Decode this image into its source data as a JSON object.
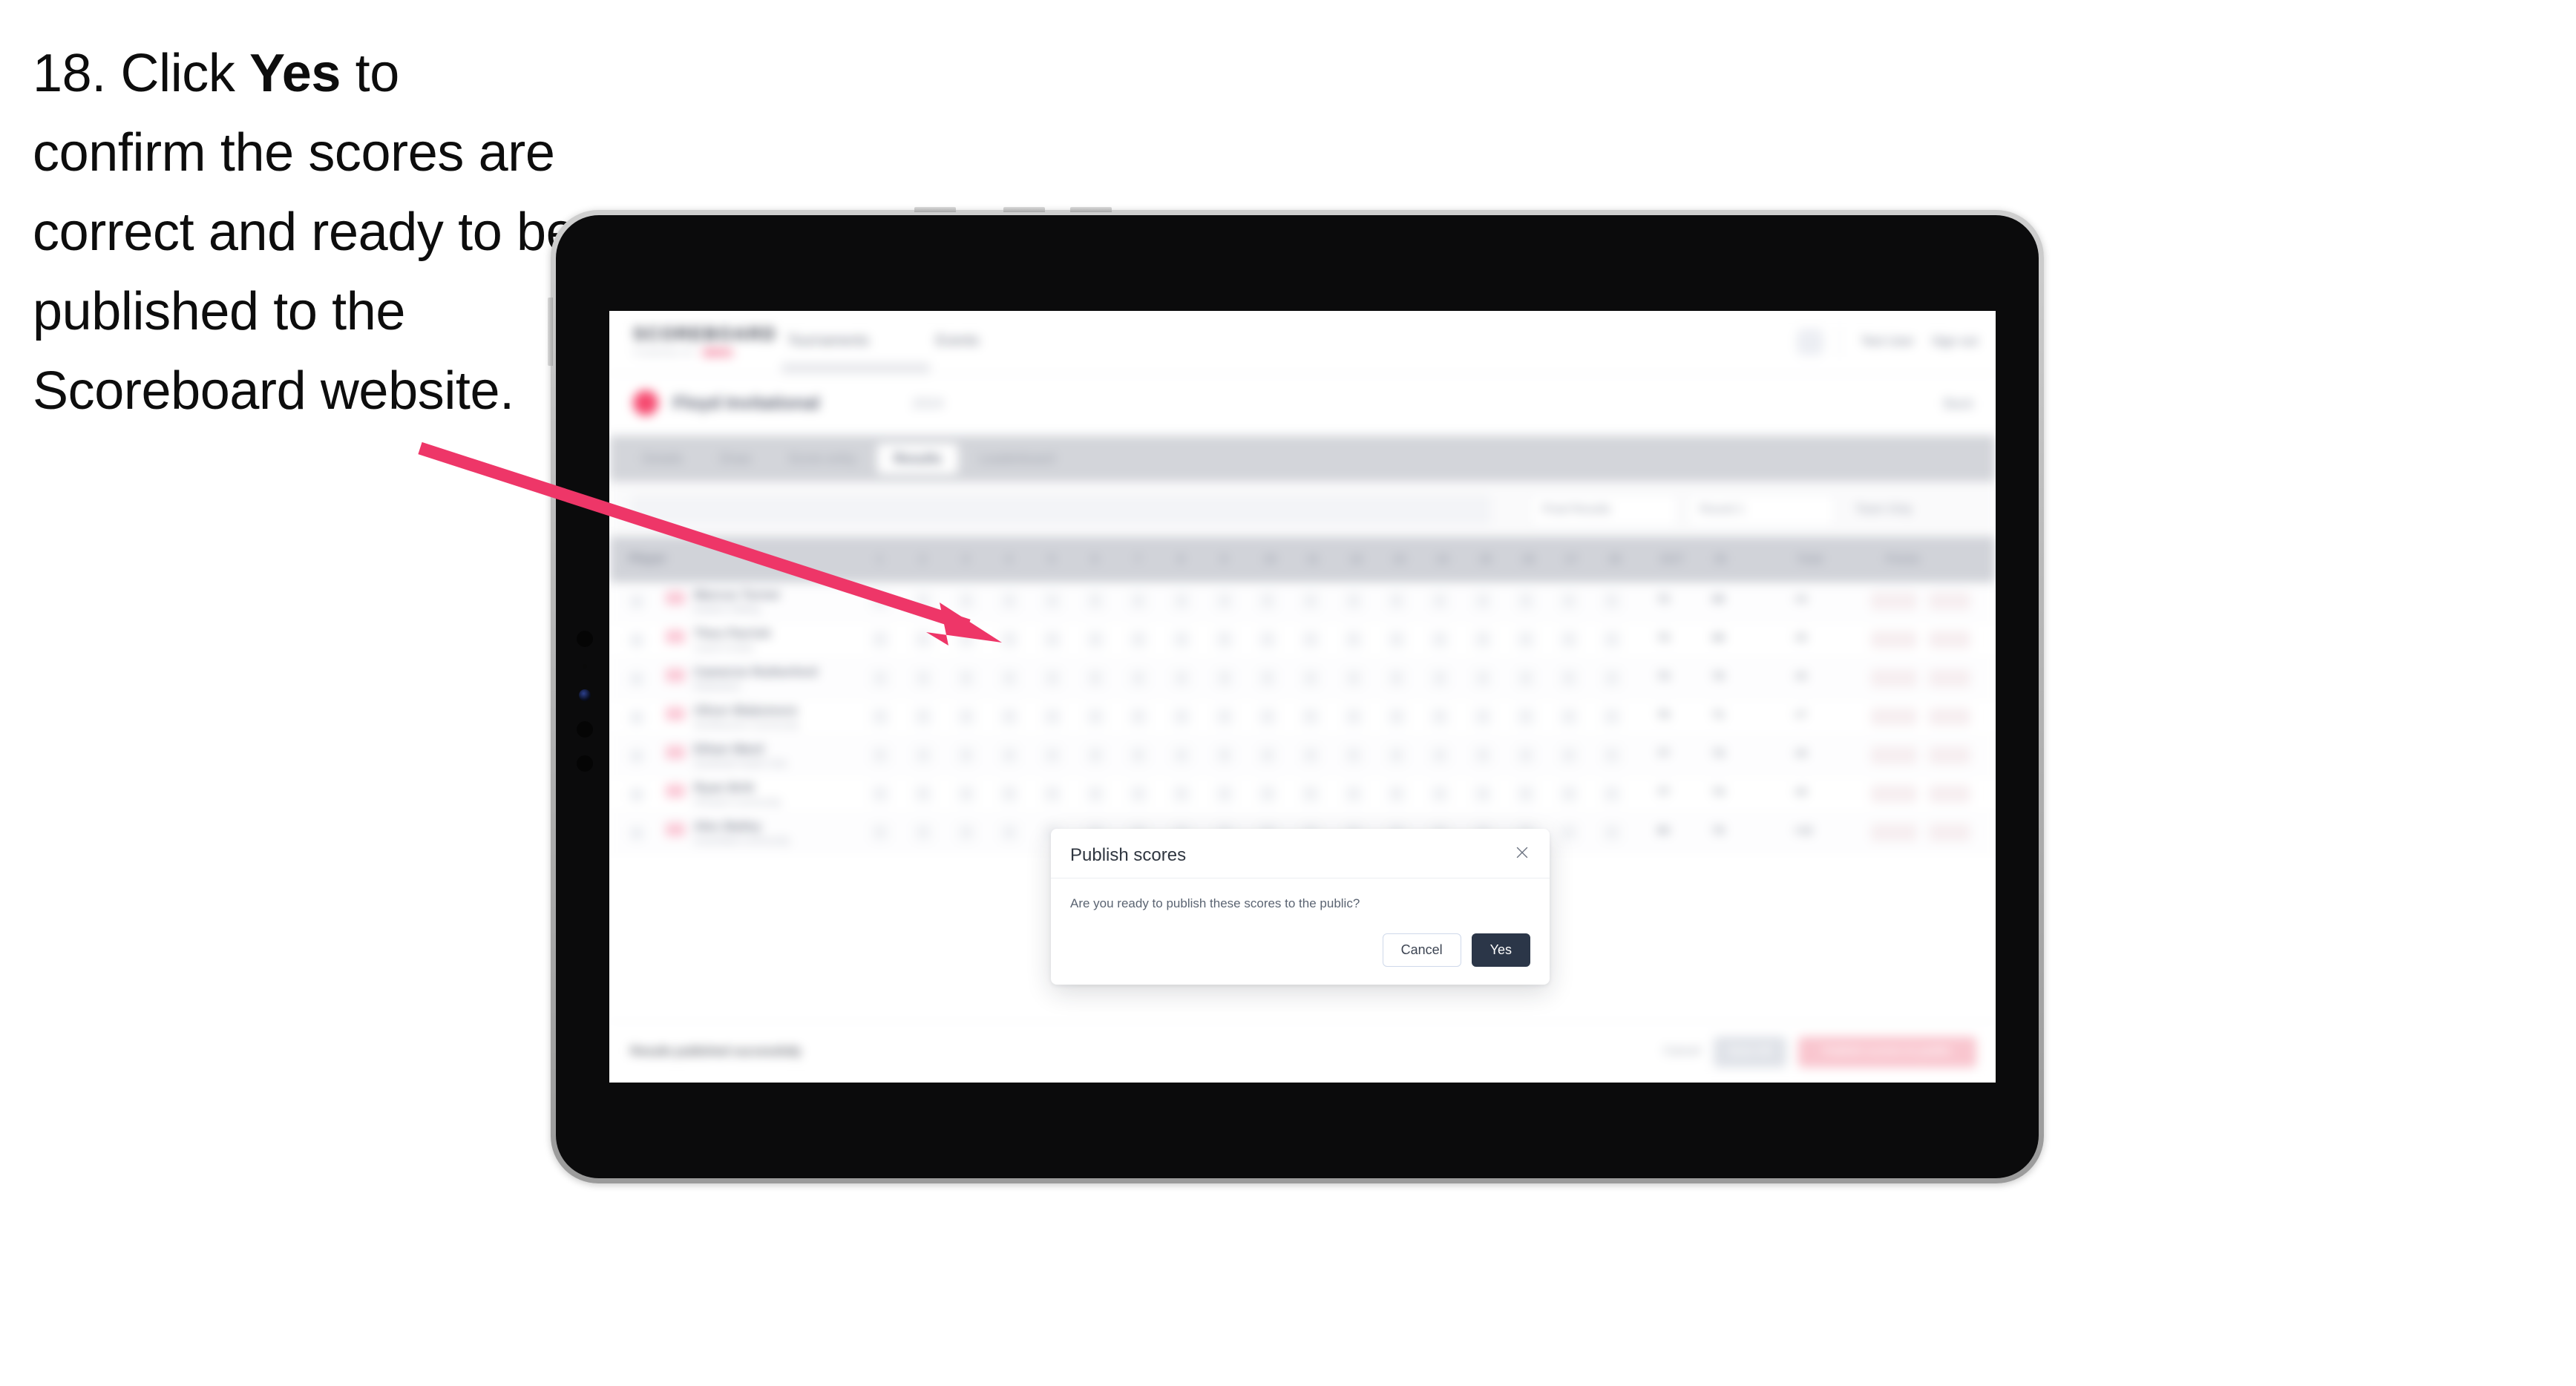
{
  "instruction": {
    "step_number": "18.",
    "text_before": "Click",
    "emphasis": "Yes",
    "text_after": "to confirm the scores are correct and ready to be published to the Scoreboard website."
  },
  "colors": {
    "arrow": "#EE3668",
    "accent_pink": "#F6496F",
    "dialog_primary_button": "#2B3648",
    "tablet_frame": "#B8B8B8",
    "tablet_bezel": "#0B0B0C",
    "tab_strip": "#D3D5DA"
  },
  "modal": {
    "title": "Publish scores",
    "message": "Are you ready to publish these scores to the public?",
    "close_icon": "close-icon",
    "cancel_label": "Cancel",
    "confirm_label": "Yes"
  },
  "app": {
    "navbar": {
      "brand": "SCOREBOARD",
      "brand_sub": "POWERED BY",
      "brand_badge": "BETA",
      "links": [
        "Tournaments",
        "Events"
      ],
      "user": "Test User",
      "sign_out": "Sign out"
    },
    "event": {
      "icon": "event-icon",
      "title": "Floyd Invitational",
      "meta": "2024",
      "back_link": "Back"
    },
    "tabs": [
      {
        "label": "Details",
        "active": false
      },
      {
        "label": "Draw",
        "active": false
      },
      {
        "label": "Score entry",
        "active": false
      },
      {
        "label": "Results",
        "active": true
      },
      {
        "label": "Leaderboard",
        "active": false
      }
    ],
    "filters": {
      "search_placeholder": "Search",
      "controls": [
        "Final Results",
        "Round 1",
        "Team Only"
      ]
    },
    "table": {
      "columns": {
        "player": "Player",
        "numbers": [
          "1",
          "2",
          "3",
          "4",
          "5",
          "6",
          "7",
          "8",
          "9",
          "10",
          "11",
          "12",
          "13",
          "14",
          "15",
          "16",
          "17",
          "18"
        ],
        "out": "OUT",
        "in": "IN",
        "total": "Total",
        "points": "Points"
      },
      "rows": [
        {
          "name": "Marcus Turner",
          "club": "Eastern Gliding",
          "cells": [
            "4",
            "5",
            "3",
            "4",
            "4",
            "5",
            "4",
            "3",
            "4",
            "5",
            "4",
            "3",
            "5",
            "4",
            "4",
            "3",
            "4",
            "5"
          ],
          "total": "72",
          "score": "68",
          "p1": "+4",
          "p2": "12"
        },
        {
          "name": "Theo Parrish",
          "club": "Laurel Cricket",
          "cells": [
            "5",
            "4",
            "4",
            "3",
            "5",
            "4",
            "3",
            "4",
            "5",
            "4",
            "4",
            "5",
            "3",
            "4",
            "5",
            "4",
            "3",
            "4"
          ],
          "total": "73",
          "score": "69",
          "p1": "+5",
          "p2": "10"
        },
        {
          "name": "Cameron Rutherford",
          "club": "Rutherford",
          "cells": [
            "4",
            "4",
            "5",
            "4",
            "3",
            "5",
            "4",
            "4",
            "3",
            "5",
            "4",
            "4",
            "5",
            "3",
            "4",
            "4",
            "5",
            "3"
          ],
          "total": "73",
          "score": "70",
          "p1": "+5",
          "p2": "9"
        },
        {
          "name": "Oliver Blakemore",
          "club": "Northbourne Community",
          "cells": [
            "3",
            "5",
            "4",
            "5",
            "4",
            "4",
            "5",
            "3",
            "4",
            "4",
            "5",
            "4",
            "3",
            "5",
            "4",
            "5",
            "4",
            "4"
          ],
          "total": "75",
          "score": "71",
          "p1": "+7",
          "p2": "8"
        },
        {
          "name": "Ethan Ward",
          "club": "Southwell Heath Club",
          "cells": [
            "5",
            "4",
            "5",
            "4",
            "4",
            "3",
            "5",
            "4",
            "5",
            "4",
            "3",
            "5",
            "4",
            "4",
            "5",
            "4",
            "4",
            "5"
          ],
          "total": "77",
          "score": "73",
          "p1": "+9",
          "p2": "7"
        },
        {
          "name": "Ryan Britt",
          "club": "Penwick Community",
          "cells": [
            "4",
            "5",
            "4",
            "5",
            "5",
            "4",
            "4",
            "5",
            "4",
            "3",
            "5",
            "4",
            "5",
            "4",
            "4",
            "5",
            "3",
            "4"
          ],
          "total": "77",
          "score": "74",
          "p1": "+9",
          "p2": "6"
        },
        {
          "name": "Alec Bailey",
          "club": "Greenfield Community",
          "cells": [
            "5",
            "5",
            "4",
            "4",
            "5",
            "4",
            "5",
            "4",
            "4",
            "5",
            "4",
            "5",
            "4",
            "5",
            "4",
            "4",
            "5",
            "4"
          ],
          "total": "80",
          "score": "76",
          "p1": "+12",
          "p2": "5"
        }
      ]
    },
    "footer": {
      "note": "Results published successfully",
      "link": "Cancel",
      "secondary_button": "Save All",
      "primary_button": "Publish scores to public"
    }
  }
}
